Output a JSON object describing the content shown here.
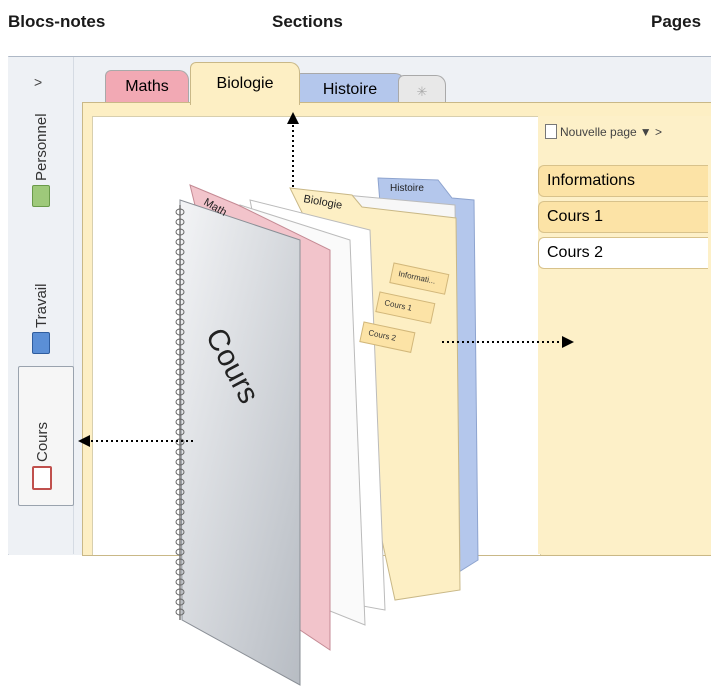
{
  "headers": {
    "notebooks": "Blocs-notes",
    "sections": "Sections",
    "pages": "Pages"
  },
  "notebooks": {
    "chevron": ">",
    "items": [
      {
        "label": "Personnel",
        "color": "#9ec97a"
      },
      {
        "label": "Travail",
        "color": "#5b8fd6"
      },
      {
        "label": "Cours",
        "color": "#c0504d"
      }
    ]
  },
  "sections": {
    "tabs": [
      {
        "label": "Maths",
        "color": "#f2a9b4"
      },
      {
        "label": "Biologie",
        "color": "#fdefc4"
      },
      {
        "label": "Histoire",
        "color": "#b4c7ec"
      },
      {
        "label": "✳",
        "color": "#e8e8e8"
      }
    ]
  },
  "pages": {
    "new_page": "Nouvelle page",
    "nav": "▼ >",
    "items": [
      "Informations",
      "Cours 1",
      "Cours 2"
    ]
  },
  "binder": {
    "cover_label": "Cours",
    "tabs": {
      "math": "Math",
      "biology": "Biologie",
      "history": "Histoire"
    },
    "page_tabs": [
      "Informati...",
      "Cours 1",
      "Cours 2"
    ]
  },
  "colors": {
    "pink": "#f2a9b4",
    "yellow": "#fdefc4",
    "blue": "#b4c7ec"
  }
}
